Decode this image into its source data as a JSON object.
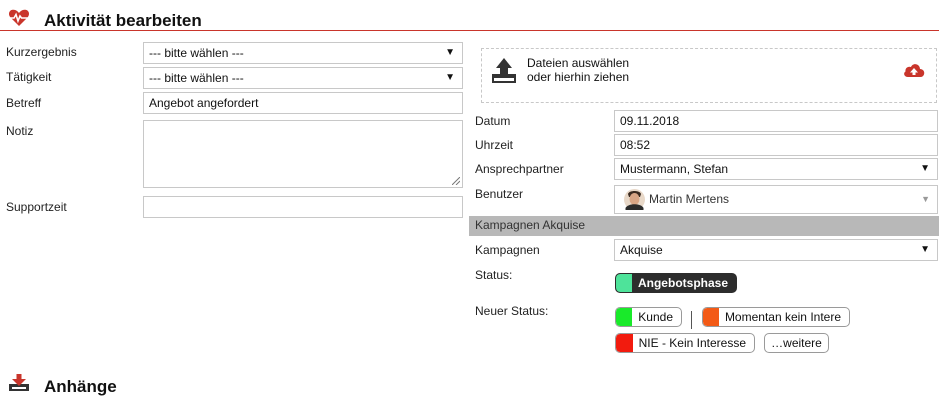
{
  "header": {
    "title": "Aktivität bearbeiten",
    "icon": "heartbeat-icon",
    "accent": "#c9352b"
  },
  "form_left": {
    "kurzergebnis": {
      "label": "Kurzergebnis",
      "value": "--- bitte wählen ---"
    },
    "taetigkeit": {
      "label": "Tätigkeit",
      "value": "--- bitte wählen ---"
    },
    "betreff": {
      "label": "Betreff",
      "value": "Angebot angefordert"
    },
    "notiz": {
      "label": "Notiz",
      "value": ""
    },
    "supportzeit": {
      "label": "Supportzeit",
      "value": ""
    }
  },
  "upload": {
    "line1": "Dateien auswählen",
    "line2": "oder hierhin ziehen",
    "icon": "upload-icon",
    "cloud_icon": "cloud-upload-icon"
  },
  "form_right": {
    "datum": {
      "label": "Datum",
      "value": "09.11.2018"
    },
    "uhrzeit": {
      "label": "Uhrzeit",
      "value": "08:52"
    },
    "ansprechpartner": {
      "label": "Ansprechpartner",
      "value": "Mustermann, Stefan"
    },
    "benutzer": {
      "label": "Benutzer",
      "value": "Martin Mertens"
    }
  },
  "kampagnen_section": {
    "title": "Kampagnen Akquise",
    "kampagnen": {
      "label": "Kampagnen",
      "value": "Akquise"
    },
    "status": {
      "label": "Status:",
      "value": "Angebotsphase",
      "color": "#4ee39a"
    },
    "neuer_status": {
      "label": "Neuer Status:",
      "options": [
        {
          "label": "Kunde",
          "color": "#19ea2a"
        },
        {
          "label": "Momentan kein Intere",
          "color": "#f35a16"
        },
        {
          "label": "NIE - Kein Interesse",
          "color": "#f21b0e"
        }
      ],
      "more_label": "…weitere"
    }
  },
  "attachments": {
    "title": "Anhänge",
    "icon": "download-tray-icon"
  }
}
